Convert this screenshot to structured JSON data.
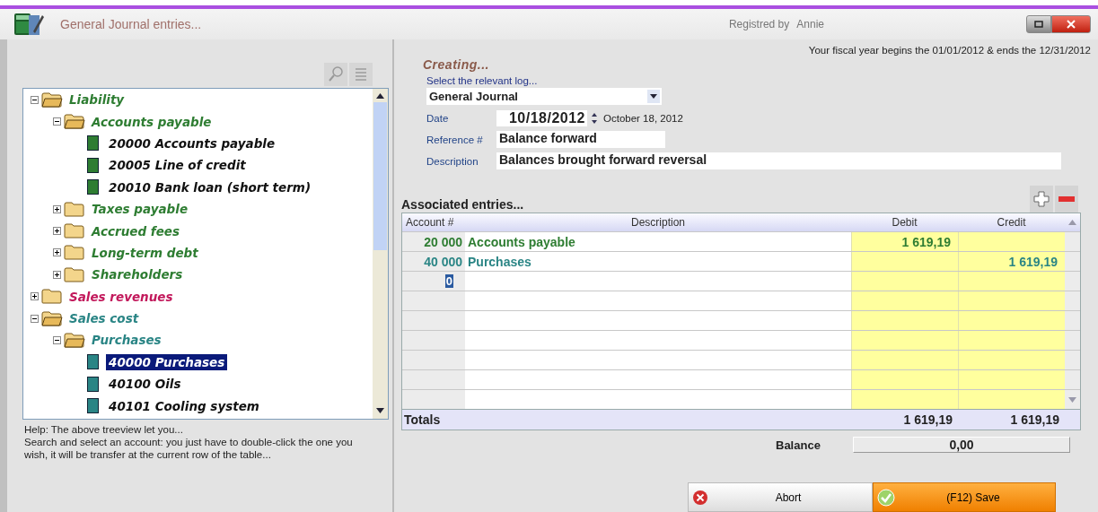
{
  "window": {
    "title": "General Journal entries...",
    "registered_label": "Registred by",
    "user": "Annie"
  },
  "tree": {
    "nodes": [
      {
        "kind": "folder",
        "label": "Liability",
        "color": "#2e7d32",
        "expanded": true,
        "selected": false,
        "children": [
          {
            "kind": "folder",
            "label": "Accounts payable",
            "expanded": true,
            "selected": false,
            "children": [
              {
                "kind": "account",
                "label": "20000 Accounts payable",
                "selected": false
              },
              {
                "kind": "account",
                "label": "20005 Line of credit",
                "selected": false
              },
              {
                "kind": "account",
                "label": "20010 Bank loan (short term)",
                "selected": false
              }
            ]
          },
          {
            "kind": "folder",
            "label": "Taxes payable",
            "expanded": false,
            "selected": false
          },
          {
            "kind": "folder",
            "label": "Accrued fees",
            "expanded": false,
            "selected": false
          },
          {
            "kind": "folder",
            "label": "Long-term debt",
            "expanded": false,
            "selected": false
          },
          {
            "kind": "folder",
            "label": "Shareholders",
            "expanded": false,
            "selected": false
          }
        ]
      },
      {
        "kind": "folder",
        "label": "Sales revenues",
        "color": "#c2185b",
        "expanded": false,
        "selected": false
      },
      {
        "kind": "folder",
        "label": "Sales cost",
        "color": "#2a8585",
        "expanded": true,
        "selected": false,
        "children": [
          {
            "kind": "folder",
            "label": "Purchases",
            "expanded": true,
            "selected": false,
            "children": [
              {
                "kind": "account",
                "label": "40000 Purchases",
                "selected": true
              },
              {
                "kind": "account",
                "label": "40100 Oils",
                "selected": false
              },
              {
                "kind": "account",
                "label": "40101 Cooling system",
                "selected": false
              }
            ]
          }
        ]
      }
    ]
  },
  "help": {
    "title": "Help: The above treeview let you...",
    "text": "Search and select an account: you just have to double-click the one you wish, it will be transfer at the current row of the table..."
  },
  "form": {
    "status": "Creating...",
    "fiscal_year": "Your fiscal year begins the 01/01/2012 & ends the 12/31/2012",
    "log_label": "Select the relevant log...",
    "log_value": "General Journal",
    "date_label": "Date",
    "date_value": "10/18/2012",
    "date_long": "October 18, 2012",
    "reference_label": "Reference #",
    "reference_value": "Balance forward",
    "description_label": "Description",
    "description_value": "Balances brought forward reversal"
  },
  "entries": {
    "title": "Associated entries...",
    "columns": [
      "Account #",
      "Description",
      "Debit",
      "Credit"
    ],
    "rows": [
      {
        "account": "20 000",
        "description": "Accounts payable",
        "debit": "1 619,19",
        "color": "#2e7d32"
      },
      {
        "account": "40 000",
        "description": "Purchases",
        "credit": "1 619,19",
        "color": "#2a8585"
      },
      {
        "account": "0",
        "editing": true
      }
    ],
    "totals_label": "Totals",
    "total_debit": "1 619,19",
    "total_credit": "1 619,19",
    "balance_label": "Balance",
    "balance": "0,00"
  },
  "buttons": [
    {
      "kind": "abort",
      "label": "Abort"
    },
    {
      "kind": "save",
      "label": "(F12) Save"
    }
  ]
}
